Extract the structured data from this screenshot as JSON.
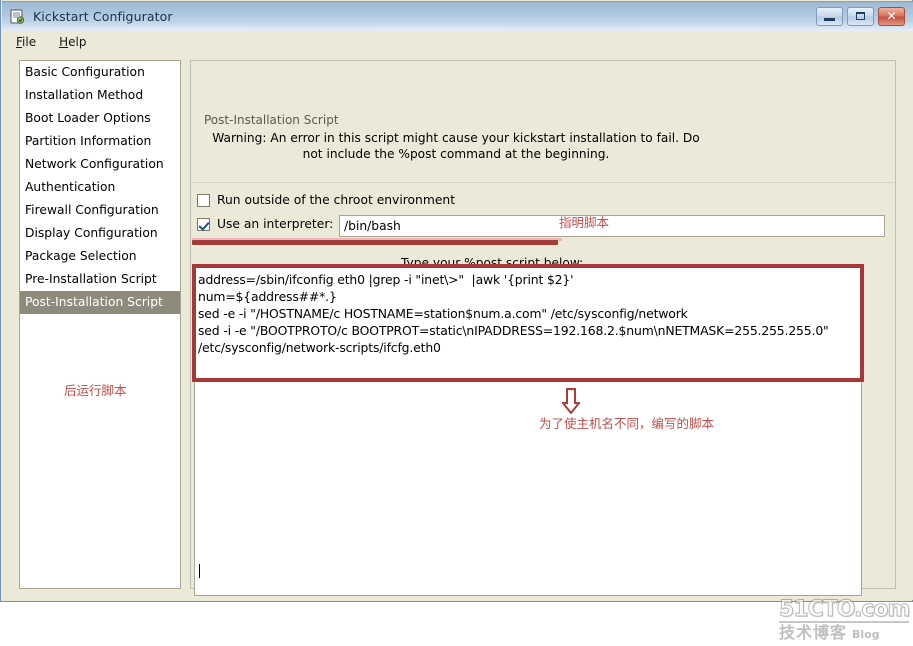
{
  "window": {
    "title": "Kickstart Configurator",
    "icon": "app-icon",
    "controls": {
      "minimize": "minimize",
      "maximize": "maximize",
      "close": "close"
    }
  },
  "menubar": {
    "items": [
      {
        "label": "File",
        "mnemonic": "F"
      },
      {
        "label": "Help",
        "mnemonic": "H"
      }
    ]
  },
  "sidebar": {
    "items": [
      {
        "label": "Basic Configuration",
        "selected": false
      },
      {
        "label": "Installation Method",
        "selected": false
      },
      {
        "label": "Boot Loader Options",
        "selected": false
      },
      {
        "label": "Partition Information",
        "selected": false
      },
      {
        "label": "Network Configuration",
        "selected": false
      },
      {
        "label": "Authentication",
        "selected": false
      },
      {
        "label": "Firewall Configuration",
        "selected": false
      },
      {
        "label": "Display Configuration",
        "selected": false
      },
      {
        "label": "Package Selection",
        "selected": false
      },
      {
        "label": "Pre-Installation Script",
        "selected": false
      },
      {
        "label": "Post-Installation Script",
        "selected": true
      }
    ],
    "annotation": "后运行脚本"
  },
  "panel": {
    "legend": "Post-Installation Script",
    "warning": "Warning: An error in this script might cause your kickstart installation to fail. Do not include the %post command at the beginning.",
    "chroot_checkbox": {
      "label": "Run outside of the chroot environment",
      "checked": false
    },
    "interpreter_checkbox": {
      "label": "Use an interpreter:",
      "checked": true
    },
    "interpreter_value": "/bin/bash",
    "interpreter_placeholder": "/bin/bash",
    "interpreter_annotation": "指明脚本",
    "script_label": "Type your %post script below:",
    "script_lines": [
      "address=/sbin/ifconfig eth0 |grep -i \"inet\\>\"  |awk '{print $2}'",
      "num=${address##*.}",
      "sed -e -i \"/HOSTNAME/c HOSTNAME=station$num.a.com\" /etc/sysconfig/network",
      "sed -i -e \"/BOOTPROTO/c BOOTPROT=static\\nIPADDRESS=192.168.2.$num\\nNETMASK=255.255.255.0\"",
      "/etc/sysconfig/network-scripts/ifcfg.eth0"
    ],
    "script_annotation": "为了使主机名不同，编写的脚本"
  },
  "watermark": {
    "top": "51CTO.com",
    "bottom_cn": "技术博客",
    "bottom_en": "Blog"
  },
  "colors": {
    "accent_red": "#a83838",
    "annotation_red": "#c0504d",
    "selection": "#8f8b7c",
    "window_bg": "#ece9d8",
    "titlebar_blue": "#a9c3dc"
  }
}
